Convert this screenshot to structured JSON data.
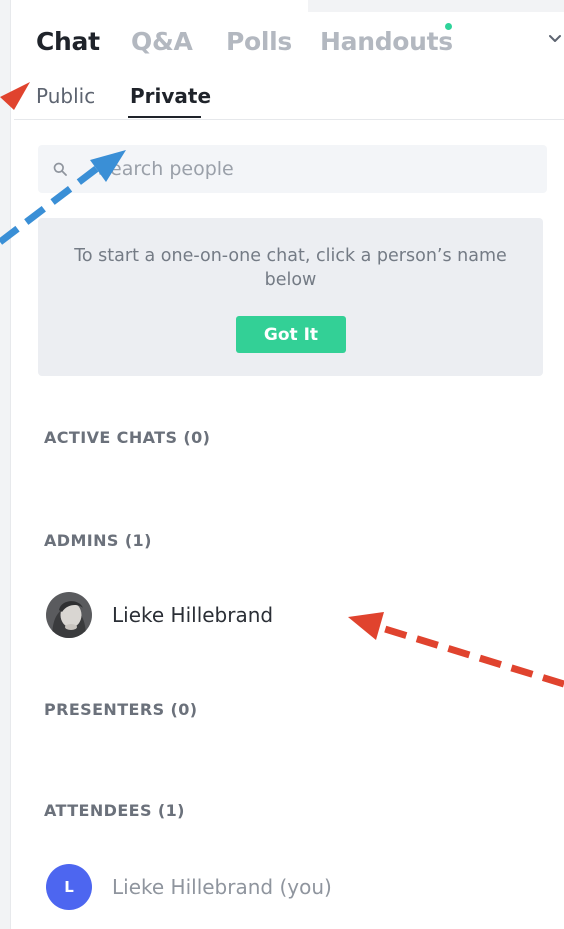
{
  "tabs": [
    {
      "label": "Chat",
      "active": true
    },
    {
      "label": "Q&A",
      "active": false
    },
    {
      "label": "Polls",
      "active": false
    },
    {
      "label": "Handouts",
      "active": false,
      "has_notification": true
    }
  ],
  "subtabs": [
    {
      "label": "Public",
      "active": false
    },
    {
      "label": "Private",
      "active": true
    }
  ],
  "search": {
    "placeholder": "Search people",
    "value": ""
  },
  "info_card": {
    "message": "To start a one-on-one chat, click a person’s name below",
    "button_label": "Got It"
  },
  "sections": {
    "active_chats": {
      "heading": "ACTIVE CHATS (0)"
    },
    "admins": {
      "heading": "ADMINS (1)",
      "people": [
        {
          "name": "Lieke Hillebrand",
          "avatar": "photo"
        }
      ]
    },
    "presenters": {
      "heading": "PRESENTERS (0)"
    },
    "attendees": {
      "heading": "ATTENDEES (1)",
      "people": [
        {
          "name": "Lieke Hillebrand (you)",
          "avatar_initial": "L"
        }
      ]
    }
  },
  "colors": {
    "accent_green": "#33d096",
    "notification_dot": "#2ed39a",
    "avatar_blue": "#4d66f0",
    "annotation_red": "#e0432e",
    "annotation_blue": "#3a8fd6"
  },
  "icons": {
    "search": "search-icon",
    "tabs_menu": "chevron-down-icon"
  }
}
